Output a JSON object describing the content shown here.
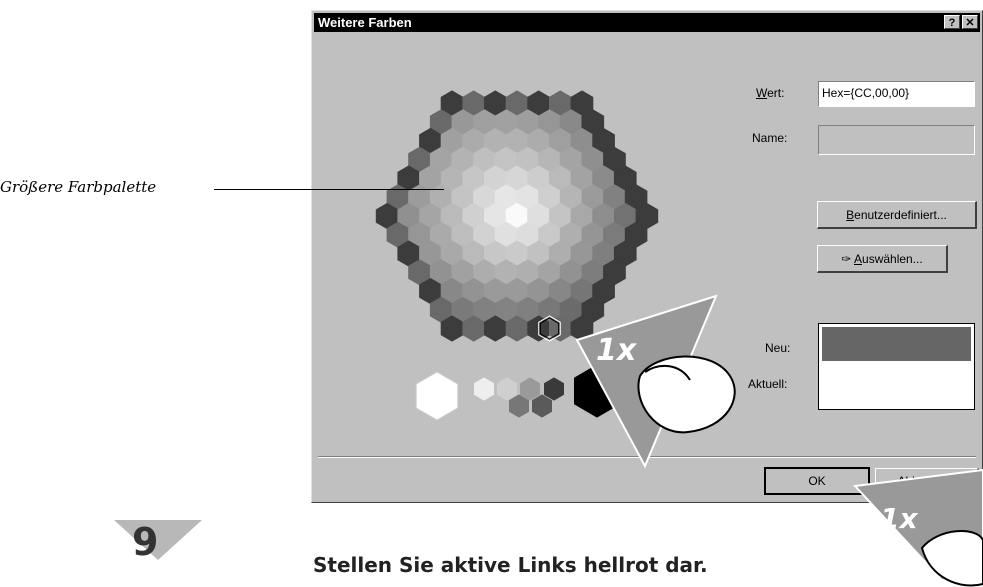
{
  "dialog": {
    "title": "Weitere Farben",
    "help_glyph": "?",
    "close_glyph": "✕",
    "wert_label": "Wert:",
    "wert_value": "Hex={CC,00,00}",
    "name_label": "Name:",
    "name_value": "",
    "custom_button": "Benutzerdefiniert...",
    "pick_button": "Auswählen...",
    "neu_label": "Neu:",
    "aktuell_label": "Aktuell:",
    "ok_button": "OK",
    "cancel_button": "Abbrechen",
    "preview_new_color": "#666666",
    "preview_current_color": "#ffffff"
  },
  "annotation": {
    "callout": "Größere Farbpalette",
    "click_badge": "1x"
  },
  "step": {
    "number": "9",
    "instruction": "Stellen Sie aktive Links hellrot dar."
  }
}
